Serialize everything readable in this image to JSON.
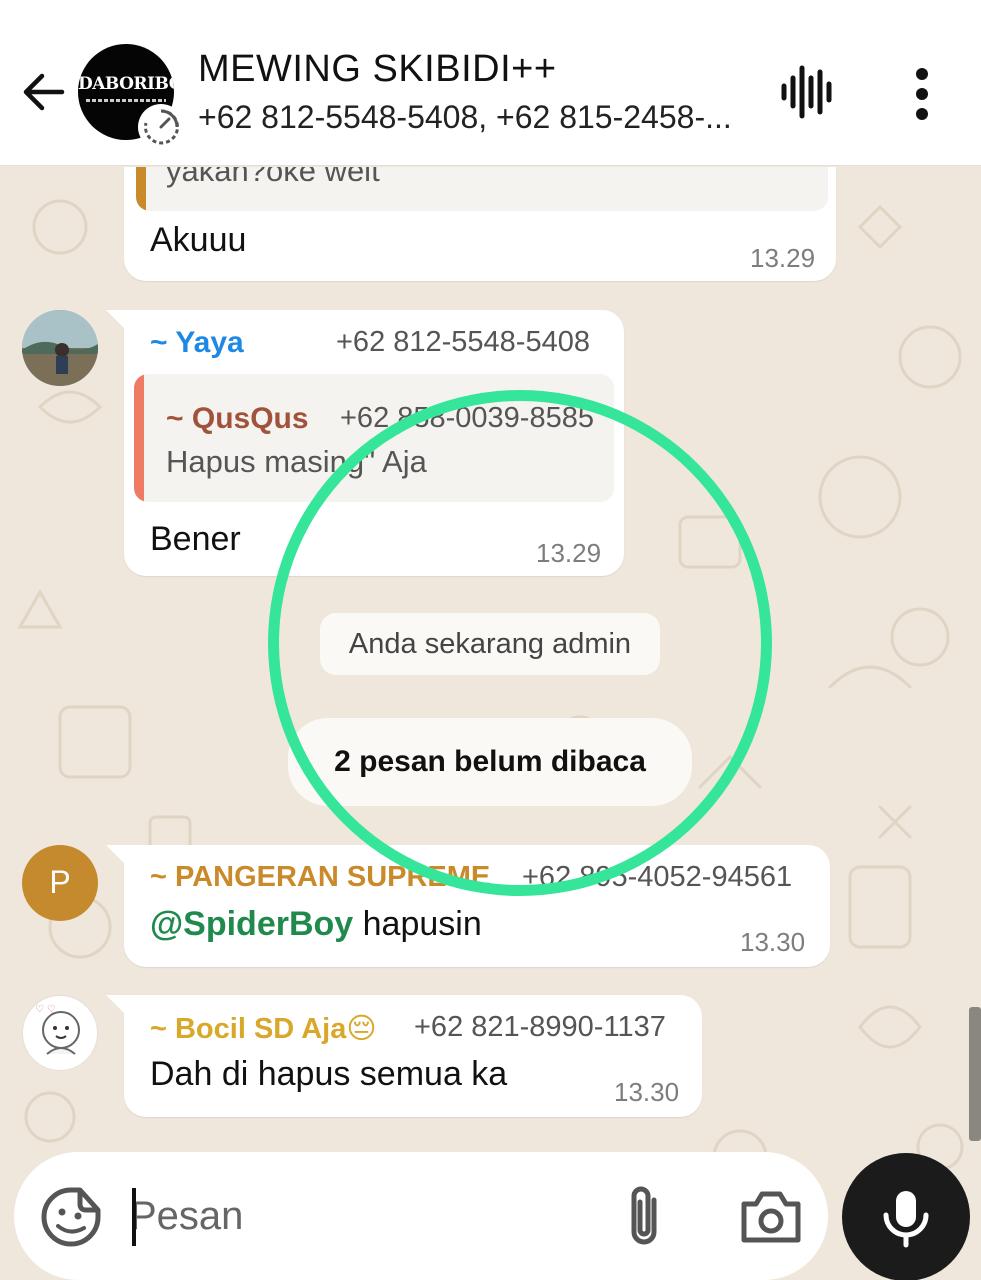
{
  "header": {
    "title": "MEWING SKIBIDI++",
    "members": "+62 812-5548-5408, +62 815-2458-...",
    "avatar_logo": "DABORIBO"
  },
  "messages": [
    {
      "quoted_text_partial": "yakan?oke weit",
      "text": "Akuuu",
      "time": "13.29"
    },
    {
      "sender": "~ Yaya",
      "phone": "+62 812-5548-5408",
      "quoted_sender": "~ QusQus",
      "quoted_phone": "+62 858-0039-8585",
      "quoted_text": "Hapus masing\" Aja",
      "text": "Bener",
      "time": "13.29"
    },
    {
      "sender": "~ PANGERAN SUPREME",
      "phone": "+62 895-4052-94561",
      "mention": "@SpiderBoy",
      "text": " hapusin",
      "time": "13.30",
      "avatar_letter": "P"
    },
    {
      "sender": "~ Bocil SD Aja😔",
      "phone": "+62 821-8990-1137",
      "text": "Dah di hapus semua ka",
      "time": "13.30"
    }
  ],
  "system": {
    "admin_notice": "Anda sekarang admin",
    "unread_notice": "2 pesan belum dibaca"
  },
  "composer": {
    "placeholder": "Pesan"
  },
  "colors": {
    "yaya_name": "#1e88e5",
    "qusqus_name": "#a0533a",
    "pangeran_name": "#c98a2a",
    "bocil_name": "#d9a82a",
    "mention": "#1f8a4c",
    "highlight": "#34e59a",
    "pangeran_avatar": "#c58a2e"
  },
  "icons": {
    "back": "arrow-left-icon",
    "voice_call": "audio-wave-icon",
    "menu": "more-vertical-icon",
    "timer": "disappearing-timer-icon",
    "sticker": "sticker-icon",
    "attach": "paperclip-icon",
    "camera": "camera-icon",
    "mic": "microphone-icon"
  }
}
